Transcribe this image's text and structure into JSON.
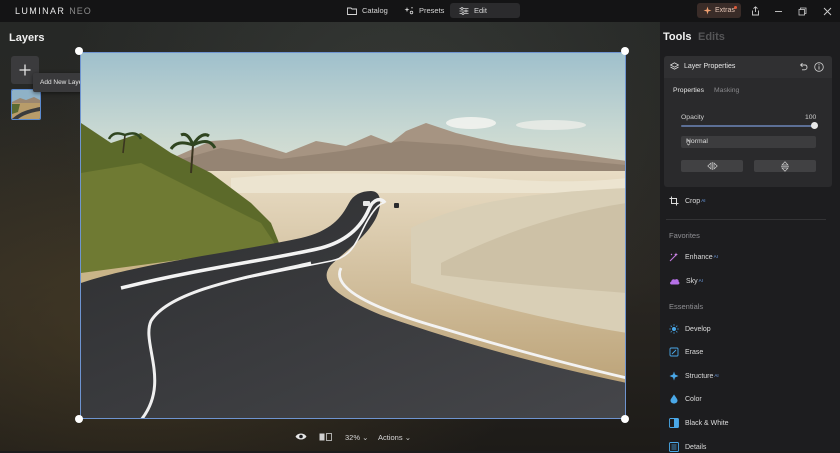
{
  "app": {
    "logo": "LUMINAR",
    "logo_suffix": "NEO"
  },
  "nav": {
    "catalog": "Catalog",
    "presets": "Presets",
    "edit": "Edit"
  },
  "extras": {
    "label": "Extras"
  },
  "layers": {
    "title": "Layers",
    "tooltip": "Add New Layer"
  },
  "bottom": {
    "zoom": "32%",
    "actions": "Actions"
  },
  "panel": {
    "tab_tools": "Tools",
    "tab_edits": "Edits",
    "layer_properties": {
      "title": "Layer Properties",
      "tab_properties": "Properties",
      "tab_masking": "Masking",
      "opacity_label": "Opacity",
      "opacity_value": "100",
      "blend_mode": "Normal"
    },
    "crop": "Crop",
    "favorites_label": "Favorites",
    "enhance": "Enhance",
    "sky": "Sky",
    "essentials_label": "Essentials",
    "develop": "Develop",
    "erase": "Erase",
    "structure": "Structure",
    "color": "Color",
    "black_white": "Black & White",
    "details": "Details",
    "ai_badge": "AI"
  },
  "colors": {
    "accent": "#6e94d0",
    "extras_bg": "#3a2c28",
    "ai_blue": "#6ea0e8"
  }
}
